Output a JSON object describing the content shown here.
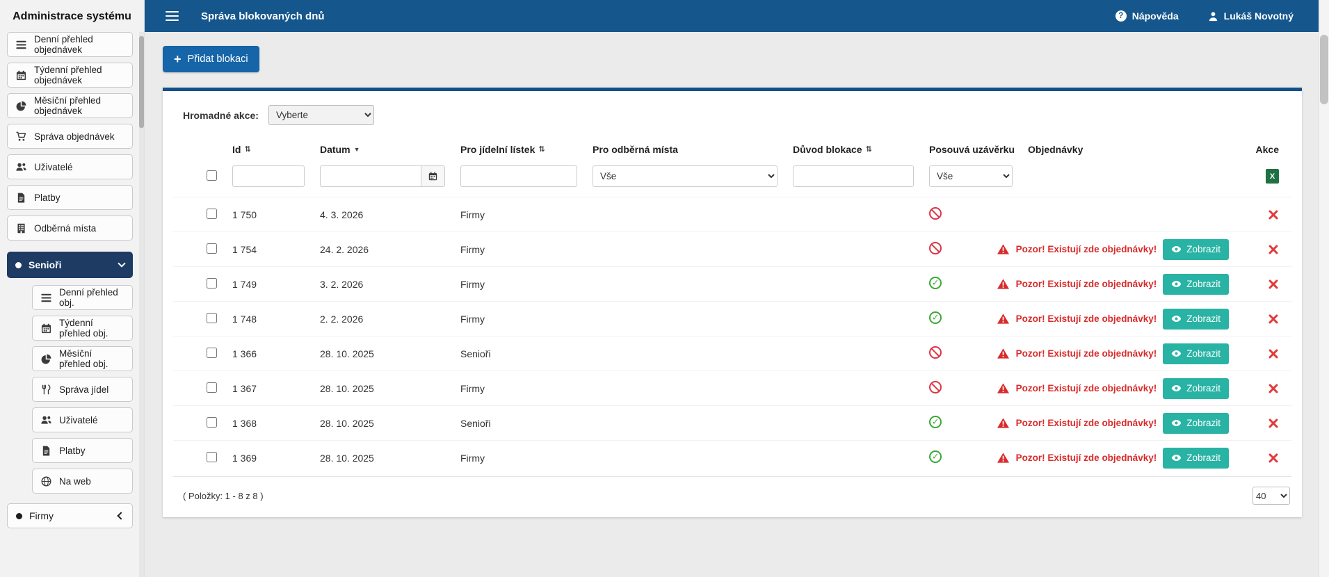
{
  "topbar": {
    "page_title": "Správa blokovaných dnů",
    "help_label": "Nápověda",
    "user_name": "Lukáš Novotný"
  },
  "sidebar": {
    "title": "Administrace systému",
    "items": [
      {
        "label": "Denní přehled objednávek",
        "icon": "list-lines-icon"
      },
      {
        "label": "Týdenní přehled objednávek",
        "icon": "calendar-icon"
      },
      {
        "label": "Měsíční přehled objednávek",
        "icon": "pie-chart-icon"
      },
      {
        "label": "Správa objednávek",
        "icon": "shopping-cart-icon"
      },
      {
        "label": "Uživatelé",
        "icon": "users-icon"
      },
      {
        "label": "Platby",
        "icon": "invoice-icon"
      },
      {
        "label": "Odběrná místa",
        "icon": "building-icon"
      }
    ],
    "seniors_group": {
      "label": "Senioři",
      "expanded": true,
      "items": [
        {
          "label": "Denní přehled obj.",
          "icon": "list-lines-icon"
        },
        {
          "label": "Týdenní přehled obj.",
          "icon": "calendar-icon"
        },
        {
          "label": "Měsíční přehled obj.",
          "icon": "pie-chart-icon"
        },
        {
          "label": "Správa jídel",
          "icon": "cutlery-icon"
        },
        {
          "label": "Uživatelé",
          "icon": "users-icon"
        },
        {
          "label": "Platby",
          "icon": "invoice-icon"
        },
        {
          "label": "Na web",
          "icon": "globe-icon"
        }
      ]
    },
    "firmy_group": {
      "label": "Firmy",
      "expanded": false
    }
  },
  "main": {
    "add_button_label": "Přidat blokaci",
    "bulk_actions": {
      "label": "Hromadné akce:",
      "selected": "Vyberte"
    },
    "table": {
      "columns": [
        {
          "label": "Id",
          "sort": "both"
        },
        {
          "label": "Datum",
          "sort": "desc"
        },
        {
          "label": "Pro jídelní lístek",
          "sort": "both"
        },
        {
          "label": "Pro odběrná místa",
          "sort": "none"
        },
        {
          "label": "Důvod blokace",
          "sort": "both"
        },
        {
          "label": "Posouvá uzávěrku",
          "sort": "none"
        },
        {
          "label": "Objednávky",
          "sort": "none"
        },
        {
          "label": "Akce",
          "sort": "none"
        }
      ],
      "filters": {
        "id_value": "",
        "date_value": "",
        "menu_value": "",
        "places_selected": "Vše",
        "reason_value": "",
        "shifts_selected": "Vše"
      },
      "orders_warning_text": "Pozor! Existují zde objednávky!",
      "show_orders_label": "Zobrazit",
      "rows": [
        {
          "id": "1 750",
          "date": "4. 3. 2026",
          "menu": "Firmy",
          "places": "",
          "reason": "",
          "shifts_deadline": "no",
          "has_orders": false
        },
        {
          "id": "1 754",
          "date": "24. 2. 2026",
          "menu": "Firmy",
          "places": "",
          "reason": "",
          "shifts_deadline": "no",
          "has_orders": true
        },
        {
          "id": "1 749",
          "date": "3. 2. 2026",
          "menu": "Firmy",
          "places": "",
          "reason": "",
          "shifts_deadline": "yes",
          "has_orders": true
        },
        {
          "id": "1 748",
          "date": "2. 2. 2026",
          "menu": "Firmy",
          "places": "",
          "reason": "",
          "shifts_deadline": "yes",
          "has_orders": true
        },
        {
          "id": "1 366",
          "date": "28. 10. 2025",
          "menu": "Senioři",
          "places": "",
          "reason": "",
          "shifts_deadline": "no",
          "has_orders": true
        },
        {
          "id": "1 367",
          "date": "28. 10. 2025",
          "menu": "Firmy",
          "places": "",
          "reason": "",
          "shifts_deadline": "no",
          "has_orders": true
        },
        {
          "id": "1 368",
          "date": "28. 10. 2025",
          "menu": "Senioři",
          "places": "",
          "reason": "",
          "shifts_deadline": "yes",
          "has_orders": true
        },
        {
          "id": "1 369",
          "date": "28. 10. 2025",
          "menu": "Firmy",
          "places": "",
          "reason": "",
          "shifts_deadline": "yes",
          "has_orders": true
        }
      ]
    },
    "footer": {
      "items_summary": "( Položky: 1 - 8 z 8 )",
      "page_size": "40"
    }
  },
  "colors": {
    "brand_blue": "#15568C",
    "active_nav_blue": "#1D3B63",
    "teal_button": "#29B3A4",
    "danger_red": "#D92B2B",
    "success_green": "#39A935",
    "excel_green": "#1E7145"
  }
}
